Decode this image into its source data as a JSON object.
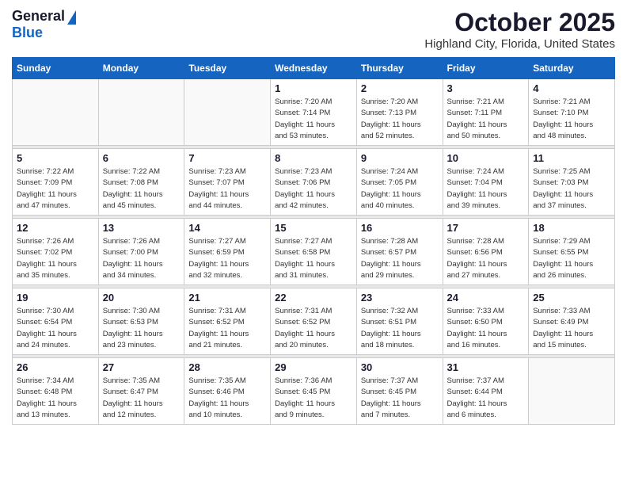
{
  "header": {
    "logo_general": "General",
    "logo_blue": "Blue",
    "month_title": "October 2025",
    "location": "Highland City, Florida, United States"
  },
  "days_of_week": [
    "Sunday",
    "Monday",
    "Tuesday",
    "Wednesday",
    "Thursday",
    "Friday",
    "Saturday"
  ],
  "weeks": [
    [
      {
        "day": "",
        "info": ""
      },
      {
        "day": "",
        "info": ""
      },
      {
        "day": "",
        "info": ""
      },
      {
        "day": "1",
        "info": "Sunrise: 7:20 AM\nSunset: 7:14 PM\nDaylight: 11 hours\nand 53 minutes."
      },
      {
        "day": "2",
        "info": "Sunrise: 7:20 AM\nSunset: 7:13 PM\nDaylight: 11 hours\nand 52 minutes."
      },
      {
        "day": "3",
        "info": "Sunrise: 7:21 AM\nSunset: 7:11 PM\nDaylight: 11 hours\nand 50 minutes."
      },
      {
        "day": "4",
        "info": "Sunrise: 7:21 AM\nSunset: 7:10 PM\nDaylight: 11 hours\nand 48 minutes."
      }
    ],
    [
      {
        "day": "5",
        "info": "Sunrise: 7:22 AM\nSunset: 7:09 PM\nDaylight: 11 hours\nand 47 minutes."
      },
      {
        "day": "6",
        "info": "Sunrise: 7:22 AM\nSunset: 7:08 PM\nDaylight: 11 hours\nand 45 minutes."
      },
      {
        "day": "7",
        "info": "Sunrise: 7:23 AM\nSunset: 7:07 PM\nDaylight: 11 hours\nand 44 minutes."
      },
      {
        "day": "8",
        "info": "Sunrise: 7:23 AM\nSunset: 7:06 PM\nDaylight: 11 hours\nand 42 minutes."
      },
      {
        "day": "9",
        "info": "Sunrise: 7:24 AM\nSunset: 7:05 PM\nDaylight: 11 hours\nand 40 minutes."
      },
      {
        "day": "10",
        "info": "Sunrise: 7:24 AM\nSunset: 7:04 PM\nDaylight: 11 hours\nand 39 minutes."
      },
      {
        "day": "11",
        "info": "Sunrise: 7:25 AM\nSunset: 7:03 PM\nDaylight: 11 hours\nand 37 minutes."
      }
    ],
    [
      {
        "day": "12",
        "info": "Sunrise: 7:26 AM\nSunset: 7:02 PM\nDaylight: 11 hours\nand 35 minutes."
      },
      {
        "day": "13",
        "info": "Sunrise: 7:26 AM\nSunset: 7:00 PM\nDaylight: 11 hours\nand 34 minutes."
      },
      {
        "day": "14",
        "info": "Sunrise: 7:27 AM\nSunset: 6:59 PM\nDaylight: 11 hours\nand 32 minutes."
      },
      {
        "day": "15",
        "info": "Sunrise: 7:27 AM\nSunset: 6:58 PM\nDaylight: 11 hours\nand 31 minutes."
      },
      {
        "day": "16",
        "info": "Sunrise: 7:28 AM\nSunset: 6:57 PM\nDaylight: 11 hours\nand 29 minutes."
      },
      {
        "day": "17",
        "info": "Sunrise: 7:28 AM\nSunset: 6:56 PM\nDaylight: 11 hours\nand 27 minutes."
      },
      {
        "day": "18",
        "info": "Sunrise: 7:29 AM\nSunset: 6:55 PM\nDaylight: 11 hours\nand 26 minutes."
      }
    ],
    [
      {
        "day": "19",
        "info": "Sunrise: 7:30 AM\nSunset: 6:54 PM\nDaylight: 11 hours\nand 24 minutes."
      },
      {
        "day": "20",
        "info": "Sunrise: 7:30 AM\nSunset: 6:53 PM\nDaylight: 11 hours\nand 23 minutes."
      },
      {
        "day": "21",
        "info": "Sunrise: 7:31 AM\nSunset: 6:52 PM\nDaylight: 11 hours\nand 21 minutes."
      },
      {
        "day": "22",
        "info": "Sunrise: 7:31 AM\nSunset: 6:52 PM\nDaylight: 11 hours\nand 20 minutes."
      },
      {
        "day": "23",
        "info": "Sunrise: 7:32 AM\nSunset: 6:51 PM\nDaylight: 11 hours\nand 18 minutes."
      },
      {
        "day": "24",
        "info": "Sunrise: 7:33 AM\nSunset: 6:50 PM\nDaylight: 11 hours\nand 16 minutes."
      },
      {
        "day": "25",
        "info": "Sunrise: 7:33 AM\nSunset: 6:49 PM\nDaylight: 11 hours\nand 15 minutes."
      }
    ],
    [
      {
        "day": "26",
        "info": "Sunrise: 7:34 AM\nSunset: 6:48 PM\nDaylight: 11 hours\nand 13 minutes."
      },
      {
        "day": "27",
        "info": "Sunrise: 7:35 AM\nSunset: 6:47 PM\nDaylight: 11 hours\nand 12 minutes."
      },
      {
        "day": "28",
        "info": "Sunrise: 7:35 AM\nSunset: 6:46 PM\nDaylight: 11 hours\nand 10 minutes."
      },
      {
        "day": "29",
        "info": "Sunrise: 7:36 AM\nSunset: 6:45 PM\nDaylight: 11 hours\nand 9 minutes."
      },
      {
        "day": "30",
        "info": "Sunrise: 7:37 AM\nSunset: 6:45 PM\nDaylight: 11 hours\nand 7 minutes."
      },
      {
        "day": "31",
        "info": "Sunrise: 7:37 AM\nSunset: 6:44 PM\nDaylight: 11 hours\nand 6 minutes."
      },
      {
        "day": "",
        "info": ""
      }
    ]
  ]
}
